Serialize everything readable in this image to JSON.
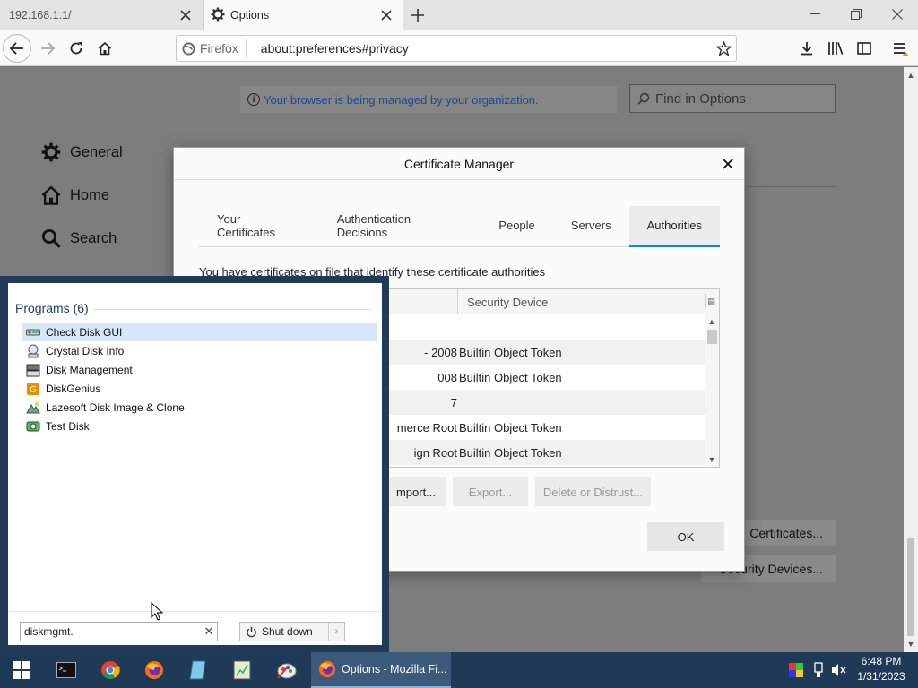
{
  "browser": {
    "tabs": [
      {
        "title": "192.168.1.1/",
        "active": false
      },
      {
        "title": "Options",
        "active": true
      }
    ],
    "identity_label": "Firefox",
    "url": "about:preferences#privacy"
  },
  "prefs": {
    "policy_notice": "Your browser is being managed by your organization.",
    "find_placeholder": "Find in Options",
    "categories": [
      {
        "label": "General",
        "icon": "gear-icon"
      },
      {
        "label": "Home",
        "icon": "home-icon"
      },
      {
        "label": "Search",
        "icon": "search-icon"
      }
    ],
    "view_certificates_label": "Certificates...",
    "security_devices_label": "Security Devices..."
  },
  "cert_dialog": {
    "title": "Certificate Manager",
    "tabs": [
      "Your Certificates",
      "Authentication Decisions",
      "People",
      "Servers",
      "Authorities"
    ],
    "active_tab": "Authorities",
    "description": "You have certificates on file that identify these certificate authorities",
    "column_security_device": "Security Device",
    "rows": [
      {
        "name": "",
        "device": ""
      },
      {
        "name": "- 2008",
        "device": "Builtin Object Token"
      },
      {
        "name": "008",
        "device": "Builtin Object Token"
      },
      {
        "name": "7",
        "device": ""
      },
      {
        "name": "merce Root",
        "device": "Builtin Object Token"
      },
      {
        "name": "ign Root",
        "device": "Builtin Object Token"
      }
    ],
    "buttons": {
      "import": "mport...",
      "export": "Export...",
      "delete": "Delete or Distrust...",
      "ok": "OK"
    }
  },
  "start_menu": {
    "section_title": "Programs (6)",
    "programs": [
      {
        "label": "Check Disk GUI",
        "icon": "check-disk-icon",
        "selected": true
      },
      {
        "label": "Crystal Disk Info",
        "icon": "crystal-disk-icon",
        "selected": false
      },
      {
        "label": "Disk Management",
        "icon": "disk-management-icon",
        "selected": false
      },
      {
        "label": "DiskGenius",
        "icon": "diskgenius-icon",
        "selected": false
      },
      {
        "label": "Lazesoft Disk Image & Clone",
        "icon": "lazesoft-icon",
        "selected": false
      },
      {
        "label": "Test Disk",
        "icon": "testdisk-icon",
        "selected": false
      }
    ],
    "search_value": "diskmgmt.",
    "shutdown_label": "Shut down"
  },
  "taskbar": {
    "active_task": "Options - Mozilla Fi...",
    "time": "6:48 PM",
    "date": "1/31/2023"
  }
}
